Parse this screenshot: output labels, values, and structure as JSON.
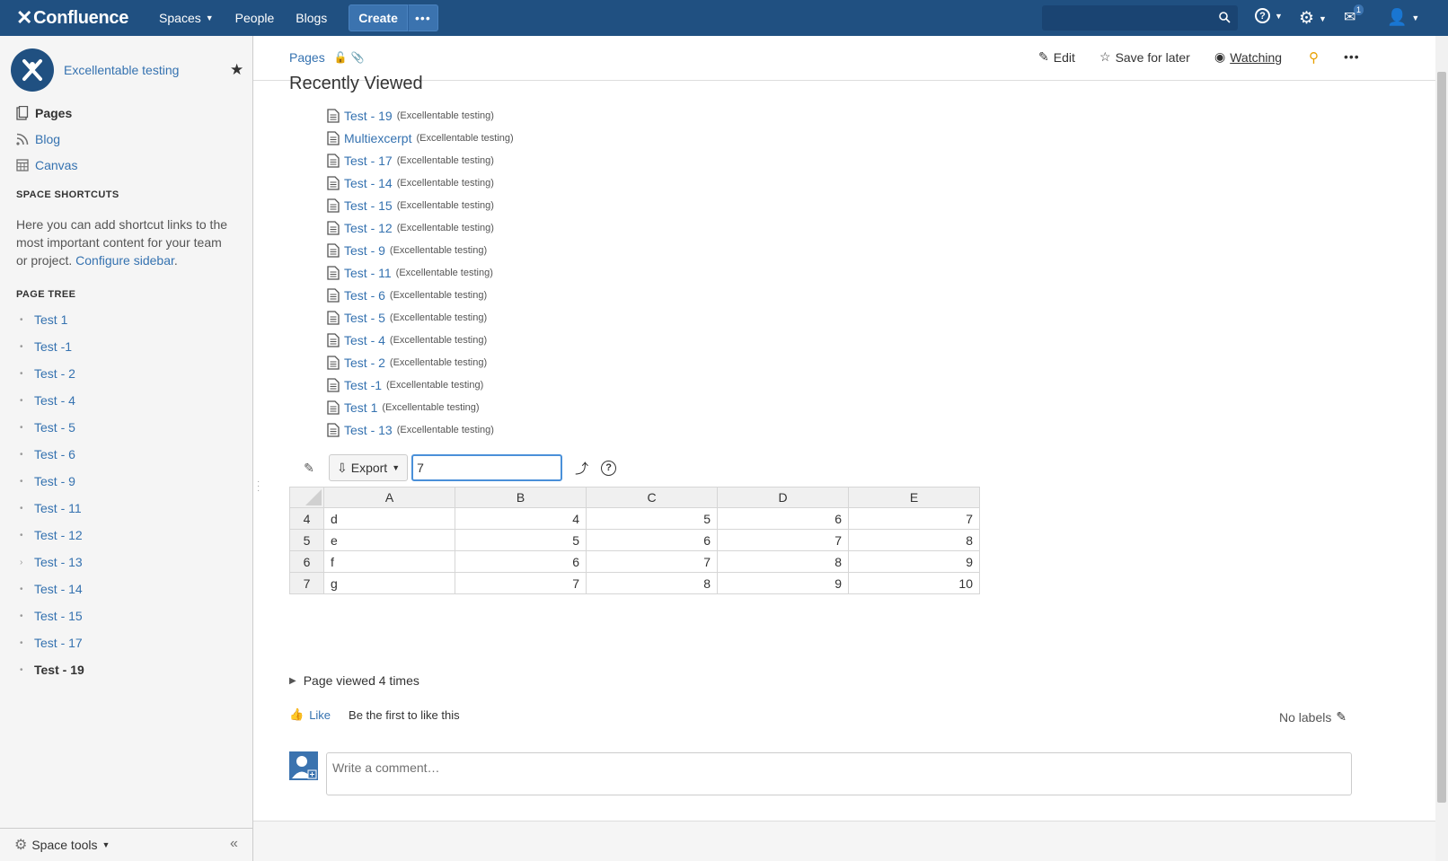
{
  "topnav": {
    "logo": "Confluence",
    "items": [
      {
        "label": "Spaces",
        "caret": true
      },
      {
        "label": "People",
        "caret": false
      },
      {
        "label": "Blogs",
        "caret": false
      }
    ],
    "create_label": "Create",
    "notification_count": "1"
  },
  "sidebar": {
    "space_name": "Excellentable testing",
    "links": [
      {
        "label": "Pages",
        "icon": "pages-icon"
      },
      {
        "label": "Blog",
        "icon": "rss-icon"
      },
      {
        "label": "Canvas",
        "icon": "calendar-icon"
      }
    ],
    "shortcuts_heading": "SPACE SHORTCUTS",
    "shortcuts_text": "Here you can add shortcut links to the most important content for your team or project.",
    "configure_link": "Configure sidebar",
    "tree_heading": "PAGE TREE",
    "tree": [
      {
        "label": "Test 1",
        "bullet": "•"
      },
      {
        "label": "Test -1",
        "bullet": "•"
      },
      {
        "label": "Test - 2",
        "bullet": "•"
      },
      {
        "label": "Test - 4",
        "bullet": "•"
      },
      {
        "label": "Test - 5",
        "bullet": "•"
      },
      {
        "label": "Test - 6",
        "bullet": "•"
      },
      {
        "label": "Test - 9",
        "bullet": "•"
      },
      {
        "label": "Test - 11",
        "bullet": "•"
      },
      {
        "label": "Test - 12",
        "bullet": "•"
      },
      {
        "label": "Test - 13",
        "bullet": "›"
      },
      {
        "label": "Test - 14",
        "bullet": "•"
      },
      {
        "label": "Test - 15",
        "bullet": "•"
      },
      {
        "label": "Test - 17",
        "bullet": "•"
      },
      {
        "label": "Test - 19",
        "bullet": "•",
        "current": true
      }
    ],
    "space_tools": "Space tools"
  },
  "page_header": {
    "breadcrumb": "Pages",
    "actions": {
      "edit": "Edit",
      "save_later": "Save for later",
      "watching": "Watching"
    }
  },
  "content": {
    "recently_viewed_title": "Recently Viewed",
    "recently_viewed": [
      {
        "title": "Test - 19",
        "space": "(Excellentable testing)"
      },
      {
        "title": "Multiexcerpt",
        "space": "(Excellentable testing)"
      },
      {
        "title": "Test - 17",
        "space": "(Excellentable testing)"
      },
      {
        "title": "Test - 14",
        "space": "(Excellentable testing)"
      },
      {
        "title": "Test - 15",
        "space": "(Excellentable testing)"
      },
      {
        "title": "Test - 12",
        "space": "(Excellentable testing)"
      },
      {
        "title": "Test - 9",
        "space": "(Excellentable testing)"
      },
      {
        "title": "Test - 11",
        "space": "(Excellentable testing)"
      },
      {
        "title": "Test - 6",
        "space": "(Excellentable testing)"
      },
      {
        "title": "Test - 5",
        "space": "(Excellentable testing)"
      },
      {
        "title": "Test - 4",
        "space": "(Excellentable testing)"
      },
      {
        "title": "Test - 2",
        "space": "(Excellentable testing)"
      },
      {
        "title": "Test -1",
        "space": "(Excellentable testing)"
      },
      {
        "title": "Test 1",
        "space": "(Excellentable testing)"
      },
      {
        "title": "Test - 13",
        "space": "(Excellentable testing)"
      }
    ],
    "export_label": "Export",
    "formula_value": "7",
    "table": {
      "columns": [
        "A",
        "B",
        "C",
        "D",
        "E"
      ],
      "rows": [
        {
          "row": "4",
          "cells": [
            "d",
            "4",
            "5",
            "6",
            "7"
          ]
        },
        {
          "row": "5",
          "cells": [
            "e",
            "5",
            "6",
            "7",
            "8"
          ]
        },
        {
          "row": "6",
          "cells": [
            "f",
            "6",
            "7",
            "8",
            "9"
          ]
        },
        {
          "row": "7",
          "cells": [
            "g",
            "7",
            "8",
            "9",
            "10"
          ]
        }
      ]
    },
    "page_viewed": "Page viewed 4 times",
    "like_label": "Like",
    "like_text": "Be the first to like this",
    "labels": "No labels",
    "comment_placeholder": "Write a comment…"
  },
  "colors": {
    "nav_bg": "#205081",
    "link": "#3572b0",
    "sidebar_bg": "#f5f5f5"
  }
}
